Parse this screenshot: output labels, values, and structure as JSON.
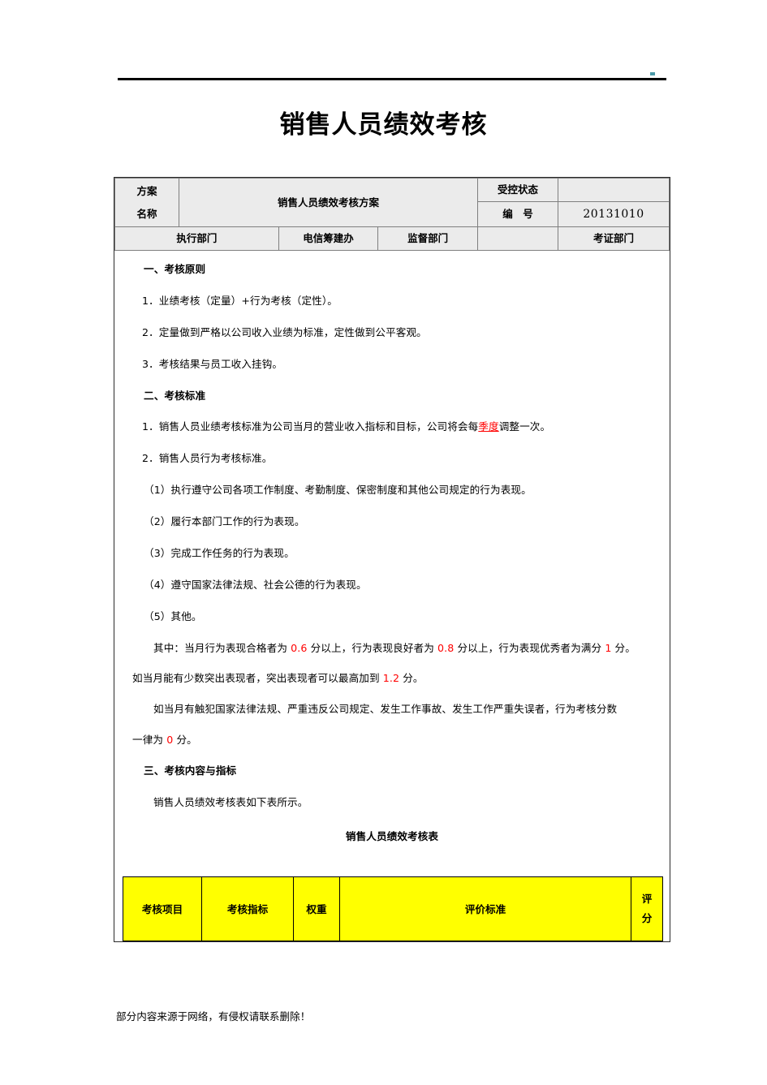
{
  "document": {
    "title": "销售人员绩效考核",
    "footer_note": "部分内容来源于网络，有侵权请联系删除！"
  },
  "header_table": {
    "scheme_name_label_line1": "方案",
    "scheme_name_label_line2": "名称",
    "scheme_name_value": "销售人员绩效考核方案",
    "controlled_status_label": "受控状态",
    "controlled_status_value": "",
    "number_label": "编　号",
    "number_value": "20131010",
    "exec_dept_label": "执行部门",
    "exec_dept_value": "电信筹建办",
    "supervise_dept_label": "监督部门",
    "supervise_dept_value": "",
    "verify_dept_label": "考证部门",
    "verify_dept_value": ""
  },
  "sections": {
    "s1_heading": "一、考核原则",
    "s1_item1": "1．业绩考核（定量）+行为考核（定性）。",
    "s1_item2": "2．定量做到严格以公司收入业绩为标准，定性做到公平客观。",
    "s1_item3": "3．考核结果与员工收入挂钩。",
    "s2_heading": "二、考核标准",
    "s2_item1_a": "1．销售人员业绩考核标准为公司当月的营业收入指标和目标，公司将会每",
    "s2_item1_hl": "季度",
    "s2_item1_b": "调整一次。",
    "s2_item2": "2．销售人员行为考核标准。",
    "s2_sub1": "（1）执行遵守公司各项工作制度、考勤制度、保密制度和其他公司规定的行为表现。",
    "s2_sub2": "（2）履行本部门工作的行为表现。",
    "s2_sub3": "（3）完成工作任务的行为表现。",
    "s2_sub4": "（4）遵守国家法律法规、社会公德的行为表现。",
    "s2_sub5": "（5）其他。",
    "p_scores_a": "其中：当月行为表现合格者为",
    "p_scores_v1": "0.6",
    "p_scores_b": "分以上，行为表现良好者为",
    "p_scores_v2": "0.8",
    "p_scores_c": "分以上，行为表现优秀者为满分",
    "p_scores_v3": "1",
    "p_scores_d": "分。",
    "p_scores_e": "如当月能有少数突出表现者，突出表现者可以最高加到",
    "p_scores_v4": "1.2",
    "p_scores_f": "分。",
    "p_penalty_a": "如当月有触犯国家法律法规、严重违反公司规定、发生工作事故、发生工作严重失误者，行为考核分数",
    "p_penalty_b": "一律为",
    "p_penalty_v": "0",
    "p_penalty_c": "分。",
    "s3_heading": "三、考核内容与指标",
    "s3_lead": "销售人员绩效考核表如下表所示。",
    "s3_table_caption": "销售人员绩效考核表"
  },
  "score_table": {
    "columns": [
      "考核项目",
      "考核指标",
      "权重",
      "评价标准",
      "评分"
    ],
    "score_col_line1": "评",
    "score_col_line2": "分",
    "rows": []
  },
  "colors": {
    "highlight_red": "#ff0000",
    "table_header_yellow": "#ffff00",
    "header_cell_gray": "#ebebeb",
    "top_mark_teal": "#4b9aa8"
  }
}
